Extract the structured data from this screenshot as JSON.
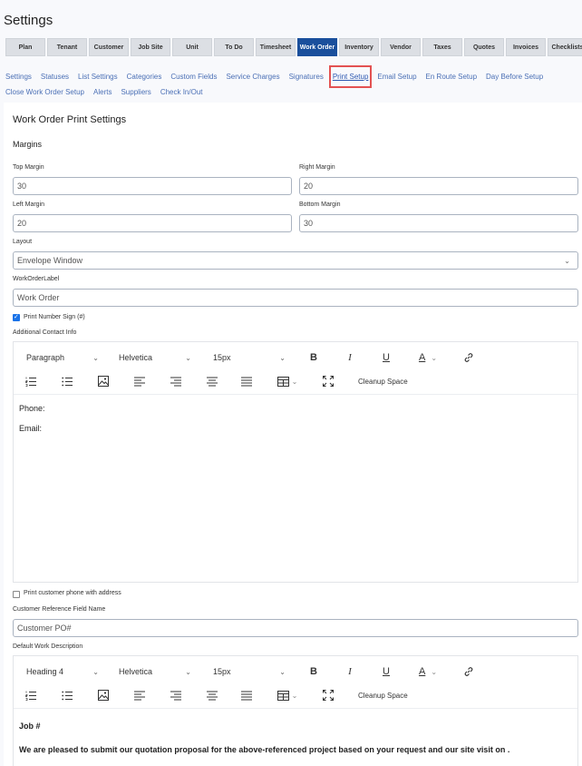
{
  "page": {
    "title": "Settings"
  },
  "tabs": [
    "Plan",
    "Tenant",
    "Customer",
    "Job Site",
    "Unit",
    "To Do",
    "Timesheet",
    "Work Order",
    "Inventory",
    "Vendor",
    "Taxes",
    "Quotes",
    "Invoices",
    "Checklists"
  ],
  "active_tab": "Work Order",
  "subnav": [
    "Settings",
    "Statuses",
    "List Settings",
    "Categories",
    "Custom Fields",
    "Service Charges",
    "Signatures",
    "Print Setup",
    "Email Setup",
    "En Route Setup",
    "Day Before Setup",
    "Close Work Order Setup",
    "Alerts",
    "Suppliers",
    "Check In/Out"
  ],
  "active_subnav": "Print Setup",
  "form": {
    "heading": "Work Order Print Settings",
    "margins_heading": "Margins",
    "top_margin_label": "Top Margin",
    "top_margin_value": "30",
    "right_margin_label": "Right Margin",
    "right_margin_value": "20",
    "left_margin_label": "Left Margin",
    "left_margin_value": "20",
    "bottom_margin_label": "Bottom Margin",
    "bottom_margin_value": "30",
    "layout_label": "Layout",
    "layout_value": "Envelope Window",
    "wo_label_label": "WorkOrderLabel",
    "wo_label_value": "Work Order",
    "print_number_sign_label": "Print Number Sign (#)",
    "print_number_sign_checked": true,
    "additional_contact_label": "Additional Contact Info",
    "print_phone_label": "Print customer phone with address",
    "print_phone_checked": false,
    "customer_ref_label": "Customer Reference Field Name",
    "customer_ref_value": "Customer PO#",
    "default_desc_label": "Default Work Description"
  },
  "editor1": {
    "block_format": "Paragraph",
    "font": "Helvetica",
    "size": "15px",
    "cleanup": "Cleanup Space",
    "lines": [
      "Phone:",
      "Email:"
    ]
  },
  "editor2": {
    "block_format": "Heading 4",
    "font": "Helvetica",
    "size": "15px",
    "cleanup": "Cleanup Space",
    "lines": [
      "Job #",
      "We are pleased to submit our quotation proposal for the above-referenced project based on your request and our site visit on ."
    ]
  },
  "toolbar_icons": {
    "bold": "B",
    "italic": "I",
    "underline": "U",
    "font_color": "A"
  },
  "chevron": "⌄"
}
